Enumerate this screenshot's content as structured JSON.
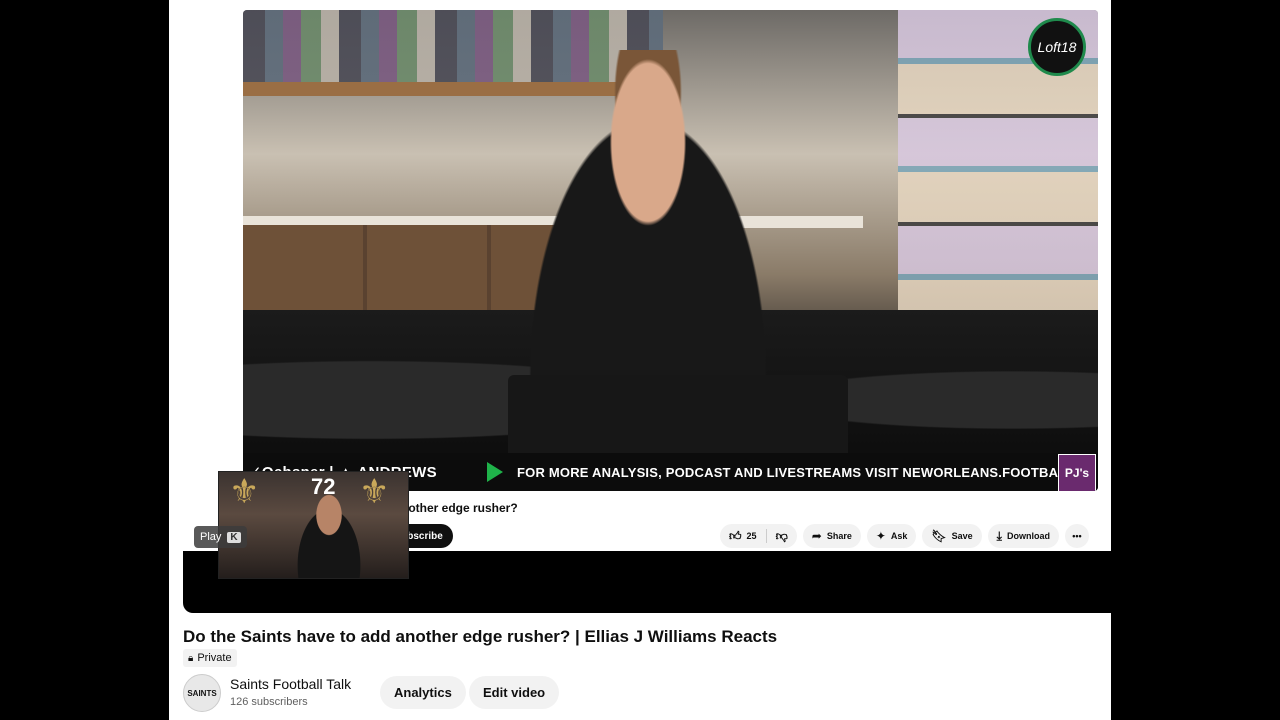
{
  "video": {
    "lower_third_sponsor": "✓Ochsner | ▲ ANDREWS",
    "lower_third_text": "FOR MORE ANALYSIS, PODCAST AND LIVESTREAMS VISIT NEWORLEANS.FOOTBALL",
    "lower_third_badge": "PJ's",
    "corner_logo": "Loft18"
  },
  "underlay": {
    "title_fragment": "nother edge rusher?",
    "subscribe_fragment": "ubscribe"
  },
  "actions": {
    "like_count": "25",
    "share": "Share",
    "ask": "Ask",
    "save": "Save",
    "download": "Download",
    "more": "•••"
  },
  "pip": {
    "jersey_number": "72",
    "tooltip_label": "Play",
    "tooltip_key": "K"
  },
  "meta": {
    "title": "Do the Saints have to add another edge rusher? | Ellias J Williams Reacts",
    "privacy": "Private",
    "channel_name": "Saints Football Talk",
    "subscribers": "126 subscribers",
    "avatar_text": "SAINTS",
    "analytics": "Analytics",
    "edit_video": "Edit video"
  }
}
